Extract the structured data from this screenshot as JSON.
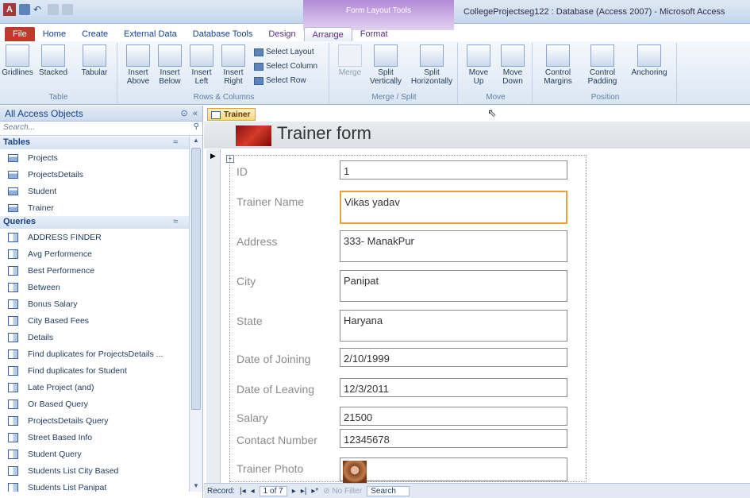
{
  "titlebar": {
    "app_icon": "A",
    "context_tools": "Form Layout Tools",
    "window_title": "CollegeProjectseg122 : Database (Access 2007) - Microsoft Access"
  },
  "tabs": [
    "File",
    "Home",
    "Create",
    "External Data",
    "Database Tools",
    "Design",
    "Arrange",
    "Format"
  ],
  "ribbon": {
    "table_group": {
      "label": "Table",
      "buttons": [
        "Gridlines",
        "Stacked",
        "Tabular"
      ]
    },
    "rows_columns_group": {
      "label": "Rows & Columns",
      "buttons": [
        "Insert\nAbove",
        "Insert\nBelow",
        "Insert\nLeft",
        "Insert\nRight"
      ],
      "small_buttons": [
        "Select Layout",
        "Select Column",
        "Select Row"
      ]
    },
    "merge_split_group": {
      "label": "Merge / Split",
      "buttons": [
        "Merge",
        "Split\nVertically",
        "Split\nHorizontally"
      ]
    },
    "move_group": {
      "label": "Move",
      "buttons": [
        "Move\nUp",
        "Move\nDown"
      ]
    },
    "position_group": {
      "label": "Position",
      "buttons": [
        "Control\nMargins",
        "Control\nPadding",
        "Anchoring"
      ]
    }
  },
  "nav": {
    "title": "All Access Objects",
    "search_placeholder": "Search...",
    "tables_label": "Tables",
    "tables": [
      "Projects",
      "ProjectsDetails",
      "Student",
      "Trainer"
    ],
    "queries_label": "Queries",
    "queries": [
      "ADDRESS FINDER",
      "Avg Performence",
      "Best Performence",
      "Between",
      "Bonus Salary",
      "City Based Fees",
      "Details",
      "Find duplicates for ProjectsDetails ...",
      "Find duplicates for Student",
      "Late Project (and)",
      "Or Based Query",
      "ProjectsDetails Query",
      "Street Based Info",
      "Student Query",
      "Students List City Based",
      "Students List Panipat"
    ]
  },
  "document": {
    "tab_label": "Trainer",
    "form_title": "Trainer form",
    "fields": [
      {
        "label": "ID",
        "value": "1"
      },
      {
        "label": "Trainer Name",
        "value": "Vikas yadav"
      },
      {
        "label": "Address",
        "value": "333- ManakPur"
      },
      {
        "label": "City",
        "value": "Panipat"
      },
      {
        "label": "State",
        "value": "Haryana"
      },
      {
        "label": "Date of Joining",
        "value": "2/10/1999"
      },
      {
        "label": "Date of Leaving",
        "value": "12/3/2011"
      },
      {
        "label": "Salary",
        "value": "21500"
      },
      {
        "label": "Contact Number",
        "value": "12345678"
      },
      {
        "label": "Trainer Photo",
        "value": ""
      }
    ]
  },
  "recnav": {
    "record_label": "Record:",
    "position": "1 of 7",
    "no_filter": "No Filter",
    "search": "Search"
  }
}
